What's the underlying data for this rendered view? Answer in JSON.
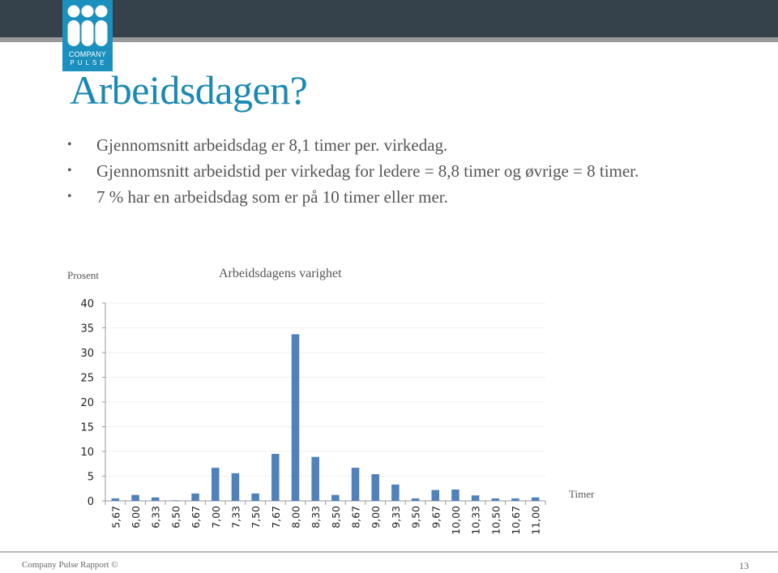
{
  "header": {
    "logo": {
      "icon": "company-pulse-logo-icon",
      "word1": "COMPANY",
      "word2": "PULSE"
    }
  },
  "slide": {
    "title": "Arbeidsdagen?",
    "bullets": [
      "Gjennomsnitt arbeidsdag er 8,1 timer per. virkedag.",
      "Gjennomsnitt arbeidstid per virkedag for ledere = 8,8 timer og øvrige = 8 timer.",
      "7 % har en arbeidsdag som er på 10 timer eller mer."
    ],
    "bullet_glyph": "•"
  },
  "chart_data": {
    "type": "bar",
    "title": "Arbeidsdagens varighet",
    "xlabel": "Timer",
    "ylabel": "Prosent",
    "ylim": [
      0,
      40
    ],
    "yticks": [
      0,
      5,
      10,
      15,
      20,
      25,
      30,
      35,
      40
    ],
    "grid": true,
    "legend": "none",
    "color": "#4f81bd",
    "categories": [
      "5,67",
      "6,00",
      "6,33",
      "6,50",
      "6,67",
      "7,00",
      "7,33",
      "7,50",
      "7,67",
      "8,00",
      "8,33",
      "8,50",
      "8,67",
      "9,00",
      "9,33",
      "9,50",
      "9,67",
      "10,00",
      "10,33",
      "10,50",
      "10,67",
      "11,00"
    ],
    "values": [
      0.5,
      1.2,
      0.7,
      0.1,
      1.5,
      6.7,
      5.6,
      1.5,
      9.5,
      33.7,
      8.9,
      1.2,
      6.7,
      5.4,
      3.3,
      0.5,
      2.2,
      2.3,
      1.1,
      0.5,
      0.5,
      0.7
    ]
  },
  "footer": {
    "left": "Company Pulse Rapport ©",
    "page": "13"
  }
}
